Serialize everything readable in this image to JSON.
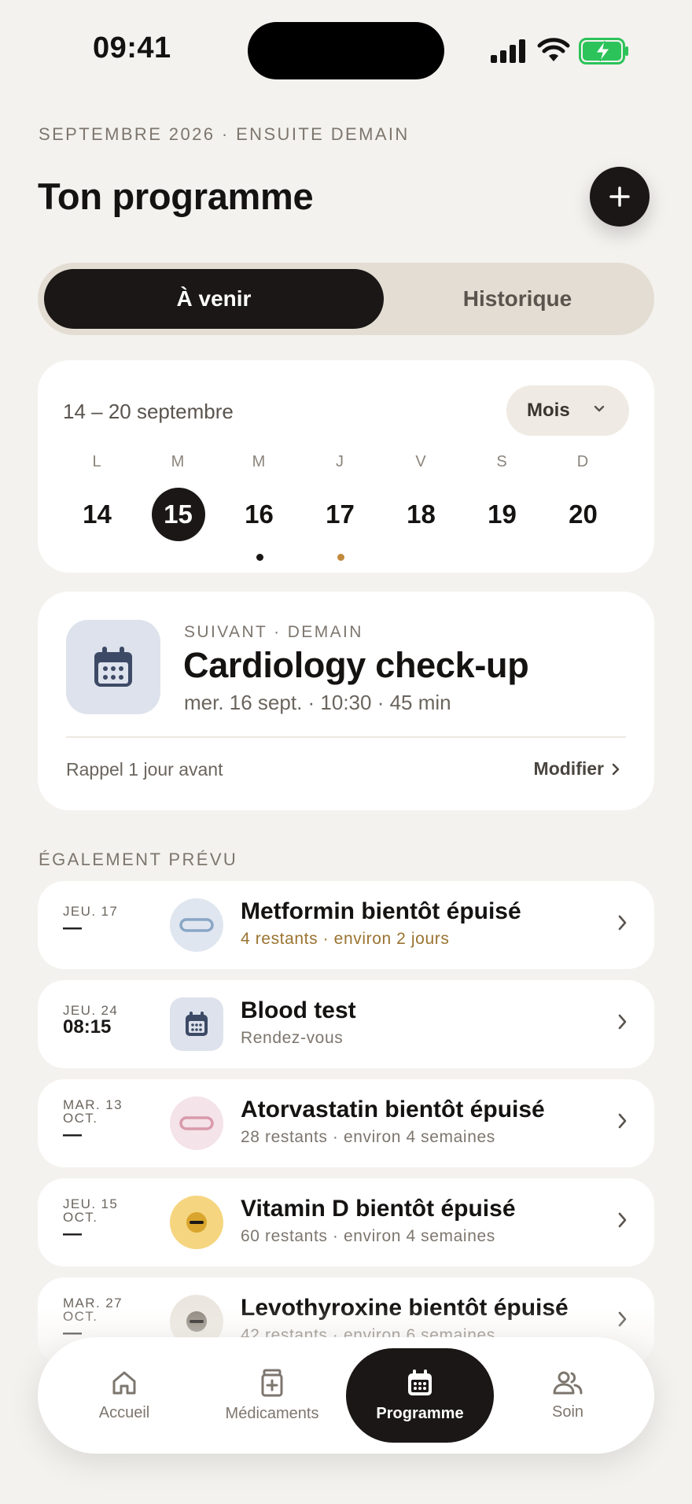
{
  "status_bar": {
    "time": "09:41"
  },
  "header": {
    "eyebrow": "SEPTEMBRE 2026 · ENSUITE DEMAIN",
    "title": "Ton programme",
    "add_icon": "plus-icon"
  },
  "segmented": {
    "active": "À venir",
    "inactive": "Historique"
  },
  "calendar": {
    "range": "14 – 20 septembre",
    "view_select": "Mois",
    "days": [
      {
        "letter": "L",
        "num": "14",
        "selected": false,
        "dot": null
      },
      {
        "letter": "M",
        "num": "15",
        "selected": true,
        "dot": null
      },
      {
        "letter": "M",
        "num": "16",
        "selected": false,
        "dot": "#1a1716"
      },
      {
        "letter": "J",
        "num": "17",
        "selected": false,
        "dot": "#c18a3c"
      },
      {
        "letter": "V",
        "num": "18",
        "selected": false,
        "dot": null
      },
      {
        "letter": "S",
        "num": "19",
        "selected": false,
        "dot": null
      },
      {
        "letter": "D",
        "num": "20",
        "selected": false,
        "dot": null
      }
    ]
  },
  "next": {
    "eyebrow": "SUIVANT · DEMAIN",
    "title": "Cardiology check-up",
    "meta": "mer. 16 sept. · 10:30 · 45 min",
    "reminder": "Rappel 1 jour avant",
    "edit": "Modifier",
    "icon": "calendar-icon"
  },
  "also": {
    "heading": "ÉGALEMENT PRÉVU",
    "items": [
      {
        "date1": "JEU. 17",
        "date2": "—",
        "title": "Metformin bientôt épuisé",
        "sub": "4 restants · environ 2 jours",
        "warn": true,
        "icon": "pill-capsule-icon",
        "icon_bg": "#dfe6ef",
        "icon_color": "#8aa6c6"
      },
      {
        "date1": "JEU. 24",
        "date2": "08:15",
        "title": "Blood test",
        "sub": "Rendez-vous",
        "warn": false,
        "icon": "calendar-icon",
        "icon_bg": "#dde2ec",
        "icon_color": "#3d4a66"
      },
      {
        "date1": "MAR. 13\nOCT.",
        "date2": "—",
        "title": "Atorvastatin bientôt épuisé",
        "sub": "28 restants · environ 4 semaines",
        "warn": false,
        "icon": "pill-capsule-icon",
        "icon_bg": "#f4e3e8",
        "icon_color": "#d99aac"
      },
      {
        "date1": "JEU. 15\nOCT.",
        "date2": "—",
        "title": "Vitamin D bientôt épuisé",
        "sub": "60 restants · environ 4 semaines",
        "warn": false,
        "icon": "tablet-icon",
        "icon_bg": "#f5d57f",
        "icon_color": "#d9a52c"
      },
      {
        "date1": "MAR. 27\nOCT.",
        "date2": "—",
        "title": "Levothyroxine bientôt épuisé",
        "sub": "42 restants · environ 6 semaines",
        "warn": false,
        "icon": "tablet-icon",
        "icon_bg": "#ebe6df",
        "icon_color": "#8b847b"
      }
    ]
  },
  "tabbar": [
    {
      "label": "Accueil",
      "icon": "home-icon",
      "active": false
    },
    {
      "label": "Médicaments",
      "icon": "medicine-bottle-icon",
      "active": false
    },
    {
      "label": "Programme",
      "icon": "calendar-icon",
      "active": true
    },
    {
      "label": "Soin",
      "icon": "people-icon",
      "active": false
    }
  ],
  "colors": {
    "background": "#f4f2ee",
    "dark": "#1a1716",
    "warn_text": "#9a7330"
  }
}
